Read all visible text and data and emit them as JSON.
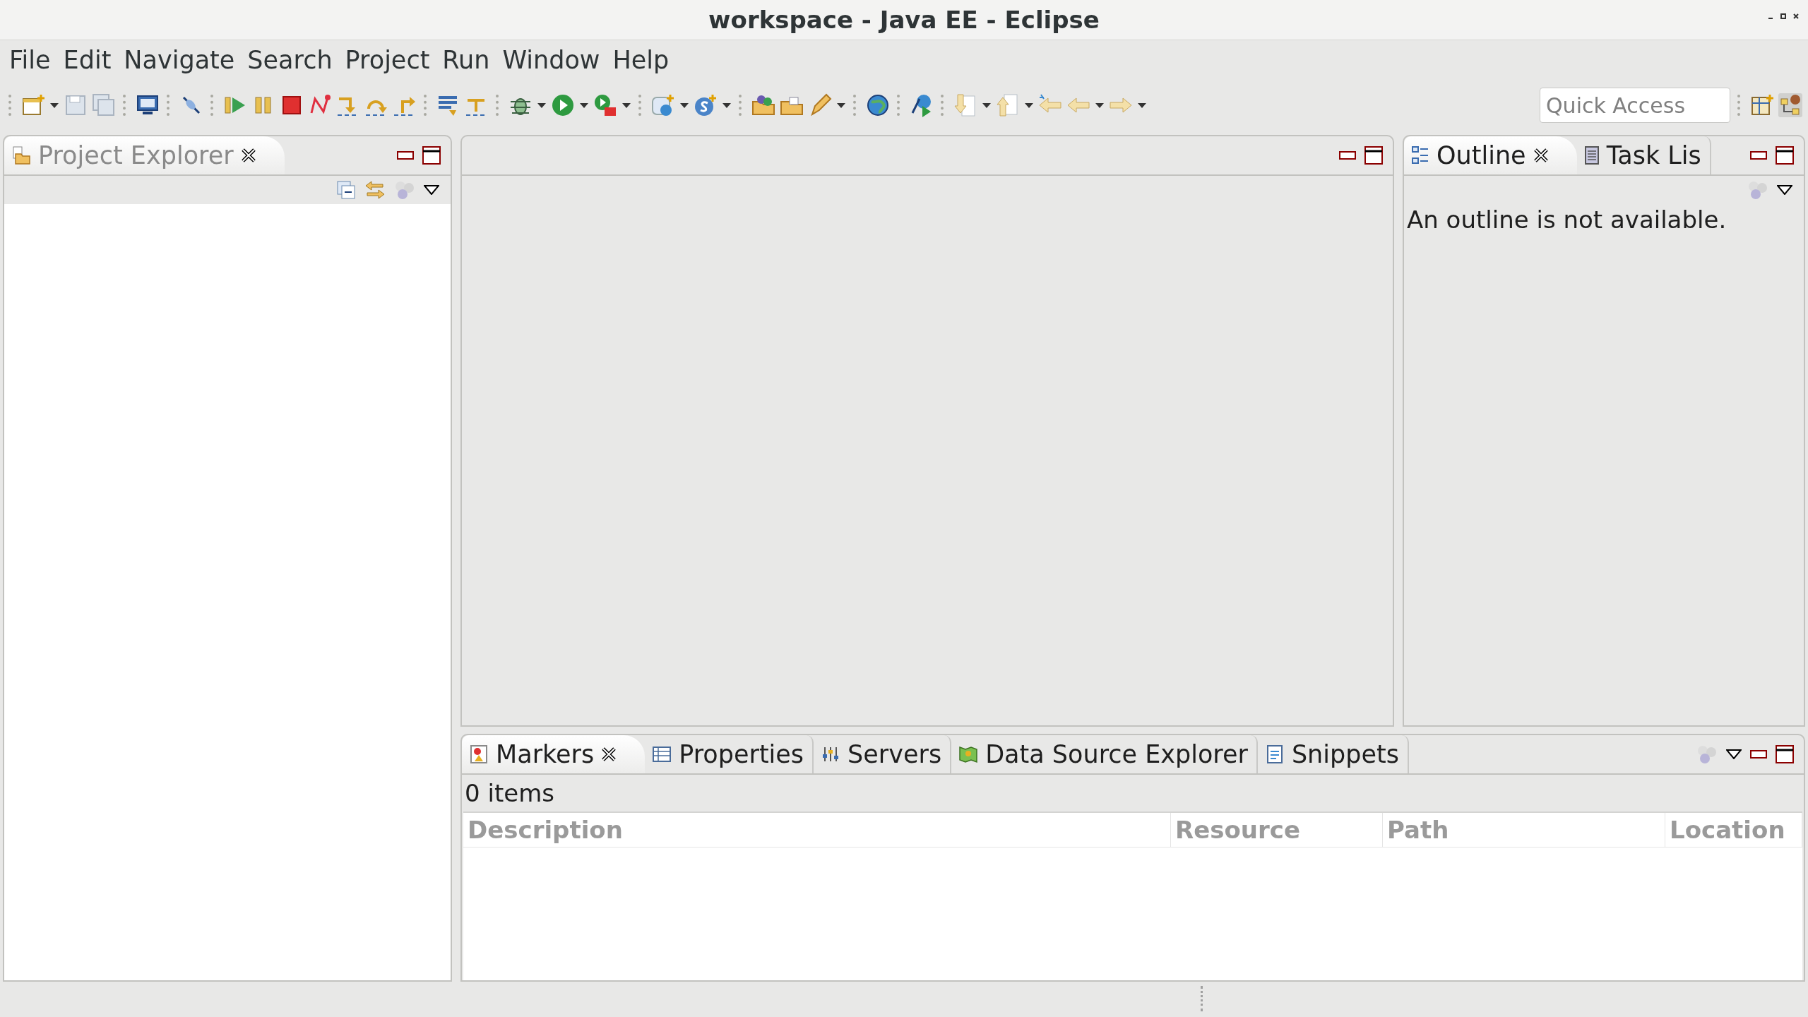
{
  "window": {
    "title": "workspace - Java EE - Eclipse"
  },
  "menu": [
    "File",
    "Edit",
    "Navigate",
    "Search",
    "Project",
    "Run",
    "Window",
    "Help"
  ],
  "quick_access": {
    "placeholder": "Quick Access"
  },
  "left_panel": {
    "tabs": [
      {
        "label": "Project Explorer",
        "selected": true
      }
    ]
  },
  "right_panel": {
    "tabs": [
      {
        "label": "Outline",
        "selected": true
      },
      {
        "label": "Task Lis",
        "selected": false
      }
    ],
    "message": "An outline is not available."
  },
  "bottom_panel": {
    "tabs": [
      {
        "label": "Markers",
        "selected": true
      },
      {
        "label": "Properties",
        "selected": false
      },
      {
        "label": "Servers",
        "selected": false
      },
      {
        "label": "Data Source Explorer",
        "selected": false
      },
      {
        "label": "Snippets",
        "selected": false
      }
    ],
    "count": "0 items",
    "columns": [
      "Description",
      "Resource",
      "Path",
      "Location"
    ]
  }
}
